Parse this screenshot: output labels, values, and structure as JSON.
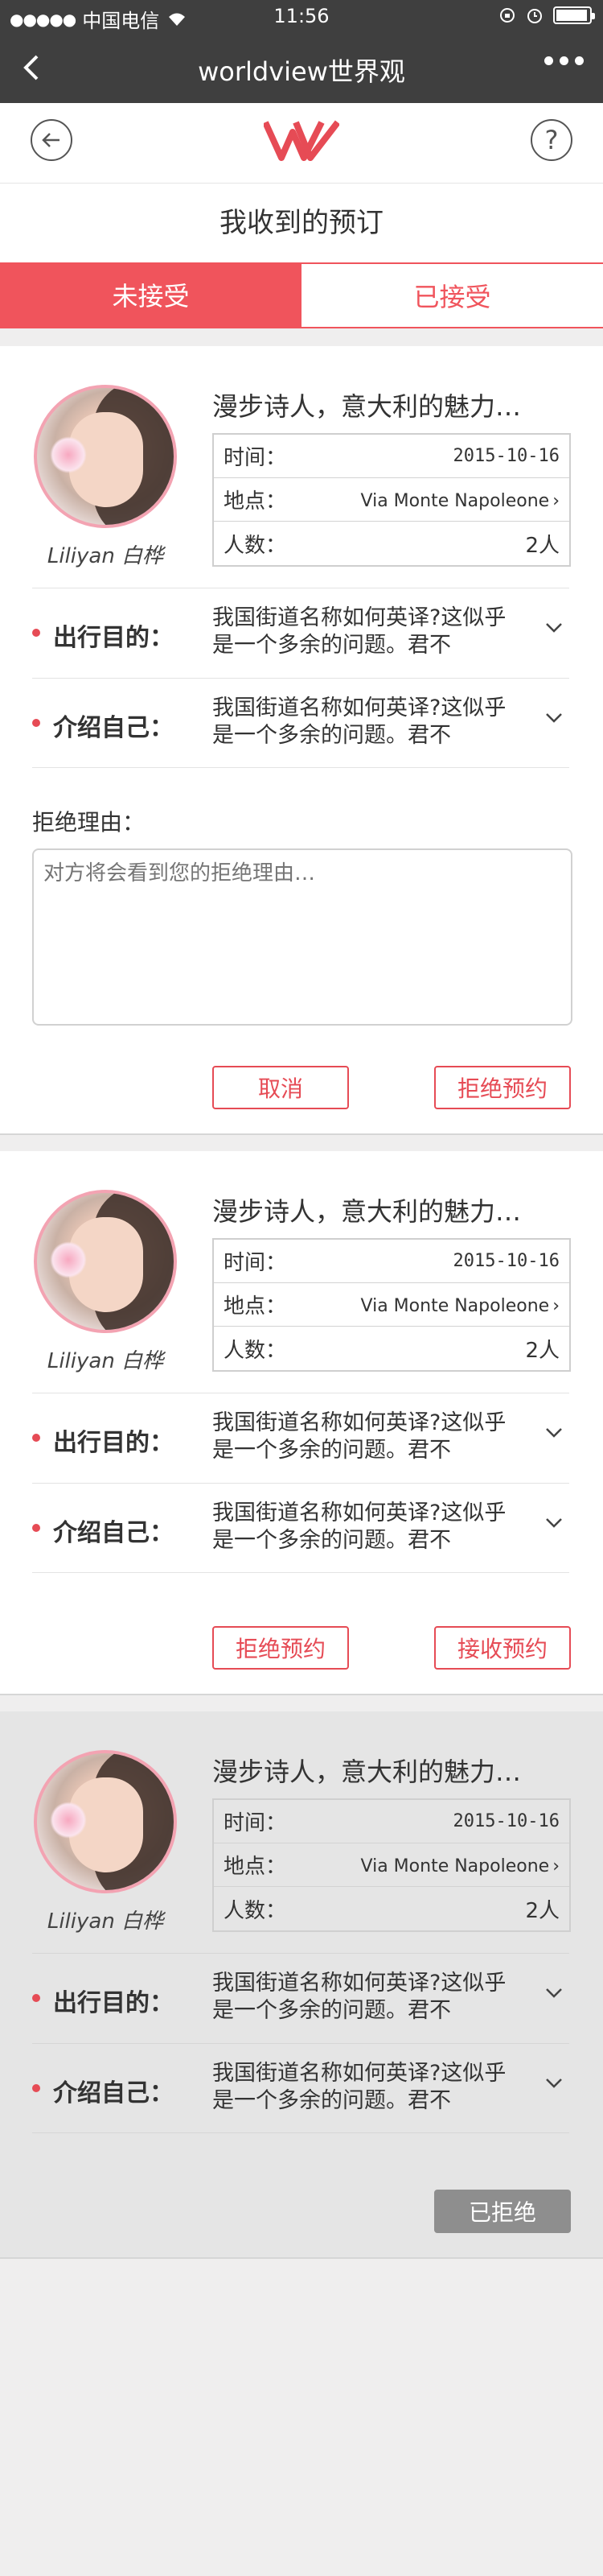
{
  "status": {
    "carrier": "中国电信",
    "time": "11:56",
    "signal": "●●●●●"
  },
  "nav": {
    "title": "worldview世界观"
  },
  "header": {
    "help": "?"
  },
  "page_title": "我收到的预订",
  "tabs": [
    {
      "label": "未接受"
    },
    {
      "label": "已接受"
    }
  ],
  "labels": {
    "time": "时间：",
    "location": "地点：",
    "people": "人数：",
    "purpose": "出行目的：",
    "intro": "介绍自己：",
    "reason": "拒绝理由：",
    "reason_placeholder": "对方将会看到您的拒绝理由…"
  },
  "cards": [
    {
      "title": "漫步诗人，意大利的魅力…",
      "name": "Liliyan 白桦",
      "date": "2015-10-16",
      "location": "Via Monte Napoleone",
      "people": "2人",
      "purpose": "我国街道名称如何英译?这似乎是一个多余的问题。君不",
      "intro": "我国街道名称如何英译?这似乎是一个多余的问题。君不",
      "buttons": [
        "取消",
        "拒绝预约"
      ]
    },
    {
      "title": "漫步诗人，意大利的魅力…",
      "name": "Liliyan 白桦",
      "date": "2015-10-16",
      "location": "Via Monte Napoleone",
      "people": "2人",
      "purpose": "我国街道名称如何英译?这似乎是一个多余的问题。君不",
      "intro": "我国街道名称如何英译?这似乎是一个多余的问题。君不",
      "buttons": [
        "拒绝预约",
        "接收预约"
      ]
    },
    {
      "title": "漫步诗人，意大利的魅力…",
      "name": "Liliyan 白桦",
      "date": "2015-10-16",
      "location": "Via Monte Napoleone",
      "people": "2人",
      "purpose": "我国街道名称如何英译?这似乎是一个多余的问题。君不",
      "intro": "我国街道名称如何英译?这似乎是一个多余的问题。君不",
      "status": "已拒绝"
    }
  ],
  "colors": {
    "accent": "#f0545c",
    "nav_bg": "#3f3f3f",
    "declined_bg": "#e5e5e5"
  }
}
